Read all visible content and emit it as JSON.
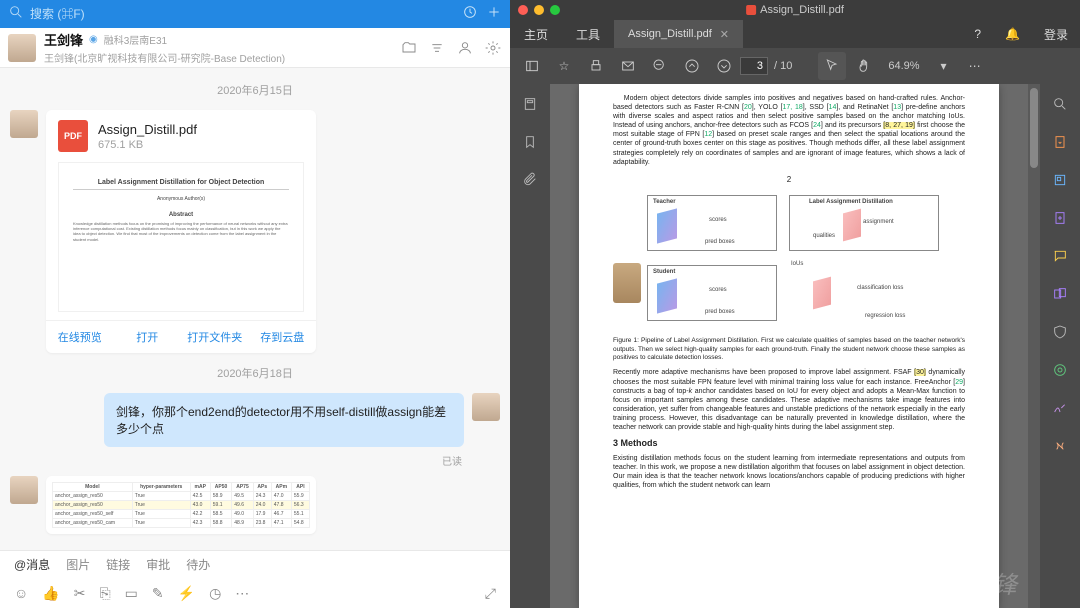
{
  "chat": {
    "search_placeholder": "搜索 (⌘F)",
    "contact": {
      "name": "王剑锋",
      "location": "融科3层南E31",
      "subtitle": "王剑锋(北京旷视科技有限公司-研究院-Base Detection)",
      "location_icon": "🔵"
    },
    "dates": {
      "d1": "2020年6月15日",
      "d2": "2020年6月18日"
    },
    "file_msg": {
      "filename": "Assign_Distill.pdf",
      "filesize": "675.1 KB",
      "pdf_badge": "PDF",
      "preview_title": "Label Assignment Distillation for Object Detection",
      "preview_author": "Anonymous Author(s)",
      "preview_abstract_h": "Abstract",
      "preview_abstract": "Knowledge distillation methods focus on the promising of improving the performance of neural networks without any extra inference computational cost. Existing distillation methods focus mainly on classification, but in this work we apply the idea to object detection. We find that most of the improvements on detection come from the label assignment in the student model.",
      "actions": {
        "preview": "在线预览",
        "open": "打开",
        "folder": "打开文件夹",
        "cloud": "存到云盘"
      }
    },
    "text_msg": "剑锋，你那个end2end的detector用不用self-distill做assign能差多少个点",
    "read_label": "已读",
    "tabs": {
      "at": "@消息",
      "pic": "图片",
      "link": "链接",
      "approve": "审批",
      "todo": "待办"
    }
  },
  "pdf": {
    "window_title": "Assign_Distill.pdf",
    "menu": {
      "home": "主页",
      "tools": "工具"
    },
    "tab_name": "Assign_Distill.pdf",
    "login": "登录",
    "page_current": "3",
    "page_total": "/ 10",
    "zoom": "64.9%",
    "body": {
      "para1": "Modern object detectors divide samples into positives and negatives based on hand-crafted rules. Anchor-based detectors such as Faster R-CNN [20], YOLO [17, 18], SSD [14], and RetinaNet [13] pre-define anchors with diverse scales and aspect ratios and then select positive samples based on the anchor matching IoUs. Instead of using anchors, anchor-free detectors such as FCOS [24] and its precursors [8, 27, 19] first choose the most suitable stage of FPN [12] based on preset scale ranges and then select the spatial locations around the center of ground-truth boxes center on this stage as positives. Though methods differ, all these label assignment strategies completely rely on coordinates of samples and are ignorant of image features, which shows a lack of adaptability.",
      "page_num": "2",
      "fig_teacher": "Teacher",
      "fig_student": "Student",
      "fig_scores": "scores",
      "fig_pred": "pred boxes",
      "fig_lad": "Label Assignment Distillation",
      "fig_assign": "assignment",
      "fig_qual": "qualities",
      "fig_iou": "IoUs",
      "fig_cls": "classification loss",
      "fig_reg": "regression loss",
      "caption": "Figure 1: Pipeline of Label Assignment Distillation. First we calculate qualities of samples based on the teacher network's outputs. Then we select high-quality samples for each ground-truth. Finally the student network choose these samples as positives to calculate detection losses.",
      "para2": "Recently more adaptive mechanisms have been proposed to improve label assignment. FSAF [30] dynamically chooses the most suitable FPN feature level with minimal training loss value for each instance. FreeAnchor [29] constructs a bag of top-k anchor candidates based on IoU for every object and adopts a Mean-Max function to focus on important samples among these candidates. These adaptive mechanisms take image features into consideration, yet suffer from changeable features and unstable predictions of the network especially in the early training process. However, this disadvantage can be naturally prevented in knowledge distillation, where the teacher network can provide stable and high-quality hints during the label assignment step.",
      "sec3": "3   Methods",
      "para3": "Existing distillation methods focus on the student learning from intermediate representations and outputs from teacher. In this work, we propose a new distillation algorithm that focuses on label assignment in object detection. Our main idea is that the teacher network knows locations/anchors capable of producing predictions with higher qualities, from which the student network can learn"
    },
    "wm": "知乎 @王剑锋"
  }
}
